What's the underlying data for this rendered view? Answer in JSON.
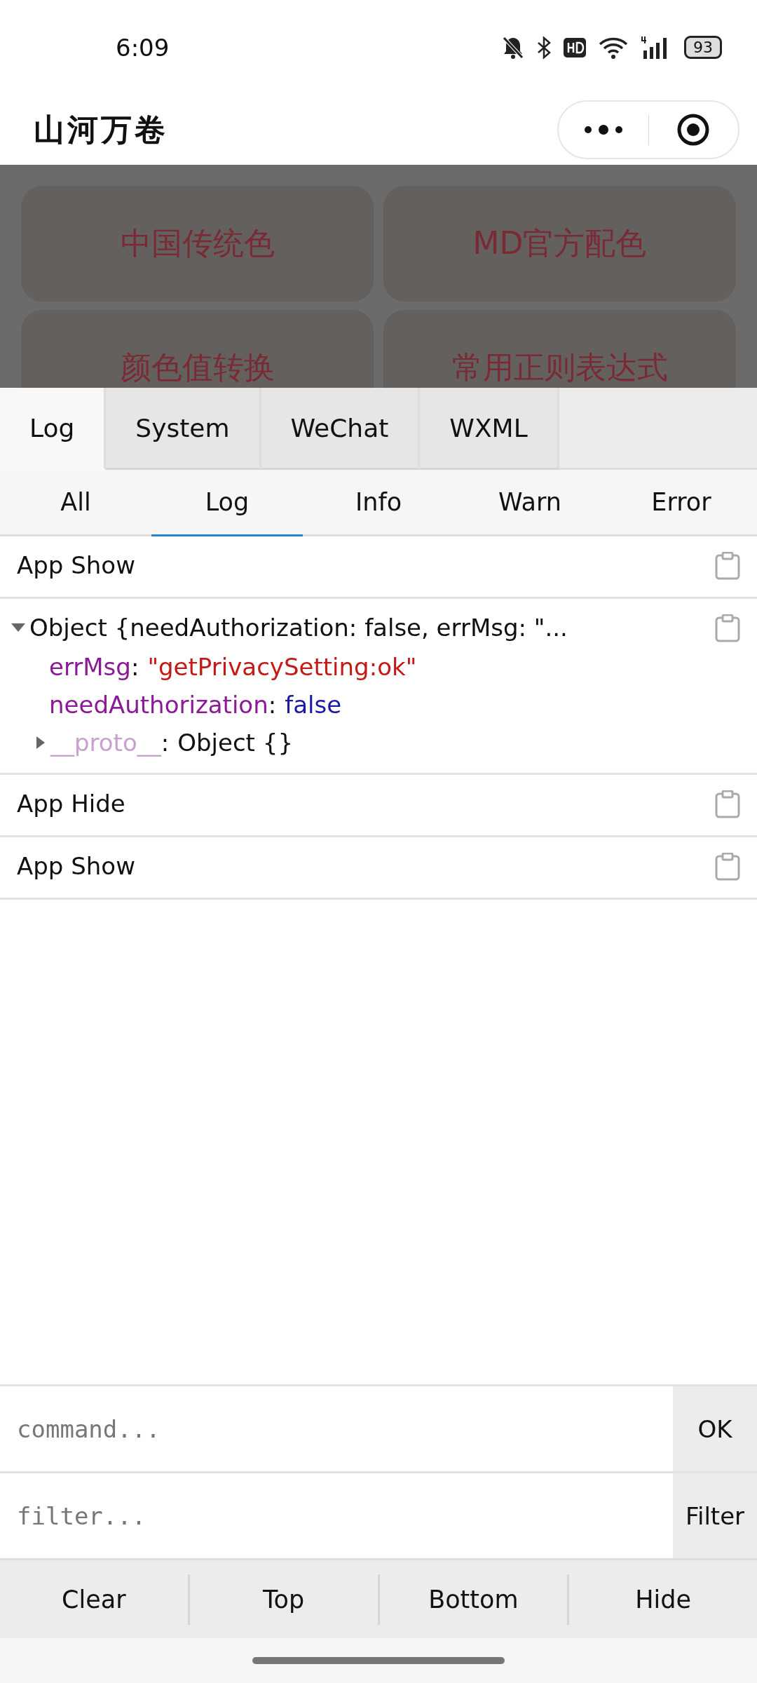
{
  "status_bar": {
    "time": "6:09",
    "battery": "93"
  },
  "header": {
    "title": "山河万卷"
  },
  "page": {
    "cards": [
      "中国传统色",
      "MD官方配色",
      "颜色值转换",
      "常用正则表达式"
    ]
  },
  "panel_tabs": [
    {
      "label": "Log",
      "selected": true
    },
    {
      "label": "System",
      "selected": false
    },
    {
      "label": "WeChat",
      "selected": false
    },
    {
      "label": "WXML",
      "selected": false
    }
  ],
  "level_tabs": [
    {
      "label": "All",
      "selected": false
    },
    {
      "label": "Log",
      "selected": true
    },
    {
      "label": "Info",
      "selected": false
    },
    {
      "label": "Warn",
      "selected": false
    },
    {
      "label": "Error",
      "selected": false
    }
  ],
  "logs": [
    {
      "kind": "text",
      "text": "App Show"
    },
    {
      "kind": "object",
      "summary": "Object {needAuthorization: false, errMsg: \"...",
      "expanded": true,
      "properties": [
        {
          "kind": "string",
          "key": "errMsg",
          "colon": ":",
          "value": "\"getPrivacySetting:ok\""
        },
        {
          "kind": "boolean",
          "key": "needAuthorization",
          "colon": ":",
          "value": "false"
        },
        {
          "kind": "proto",
          "key": "__proto__",
          "colon": ":",
          "value": "Object {}",
          "expanded": false
        }
      ]
    },
    {
      "kind": "text",
      "text": "App Hide"
    },
    {
      "kind": "text",
      "text": "App Show"
    }
  ],
  "command": {
    "placeholder": "command...",
    "button": "OK"
  },
  "filter": {
    "placeholder": "filter...",
    "button": "Filter"
  },
  "actions": [
    "Clear",
    "Top",
    "Bottom",
    "Hide"
  ]
}
